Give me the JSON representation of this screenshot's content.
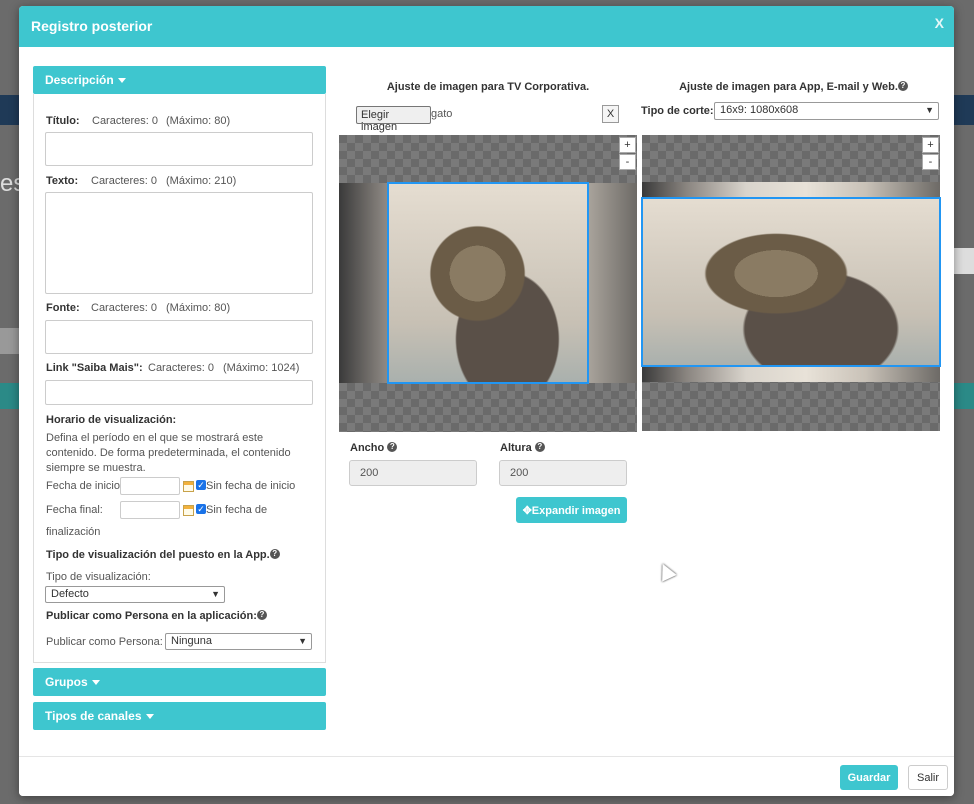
{
  "modal": {
    "title": "Registro posterior",
    "close_label": "X"
  },
  "descripcion": {
    "header": "Descripción",
    "titulo": {
      "label": "Título:",
      "count": "Caracteres: 0",
      "max": "(Máximo: 80)",
      "value": ""
    },
    "texto": {
      "label": "Texto:",
      "count": "Caracteres: 0",
      "max": "(Máximo: 210)",
      "value": ""
    },
    "fonte": {
      "label": "Fonte:",
      "count": "Caracteres: 0",
      "max": "(Máximo: 80)",
      "value": ""
    },
    "link": {
      "label": "Link \"Saiba Mais\":",
      "count": "Caracteres: 0",
      "max": "(Máximo: 1024)",
      "value": ""
    },
    "horario": {
      "title": "Horario de visualización:",
      "help": "Defina el período en el que se mostrará este contenido. De forma predeterminada, el contenido siempre se muestra.",
      "inicio_label": "Fecha de inicio:",
      "inicio_check": "Sin fecha de inicio",
      "final_label": "Fecha final:",
      "final_check_a": "Sin fecha de",
      "final_check_b": "finalización"
    },
    "tipo_vis": {
      "title": "Tipo de visualización del puesto en la App.",
      "label": "Tipo de visualización:",
      "selected": "Defecto"
    },
    "persona": {
      "title": "Publicar como Persona en la aplicación:",
      "label": "Publicar como Persona:",
      "selected": "Ninguna"
    }
  },
  "grupos": {
    "header": "Grupos"
  },
  "canales": {
    "header": "Tipos de canales"
  },
  "tv": {
    "title": "Ajuste de imagen para TV Corporativa.",
    "choose_button": "Elegir imagen",
    "file_name": "gato",
    "clear_button": "X",
    "ancho_label": "Ancho",
    "ancho_value": "200",
    "altura_label": "Altura",
    "altura_value": "200",
    "expand_button": "Expandir imagen"
  },
  "app": {
    "title": "Ajuste de imagen para App, E-mail y Web.",
    "corte_label": "Tipo de corte:",
    "corte_selected": "16x9: 1080x608"
  },
  "zoom": {
    "plus": "+",
    "minus": "-"
  },
  "footer": {
    "save": "Guardar",
    "exit": "Salir"
  },
  "colors": {
    "accent": "#3ec6cf",
    "crop": "#2196f3"
  },
  "icons": {
    "help": "?",
    "expand": "✥",
    "caret": "▾"
  }
}
